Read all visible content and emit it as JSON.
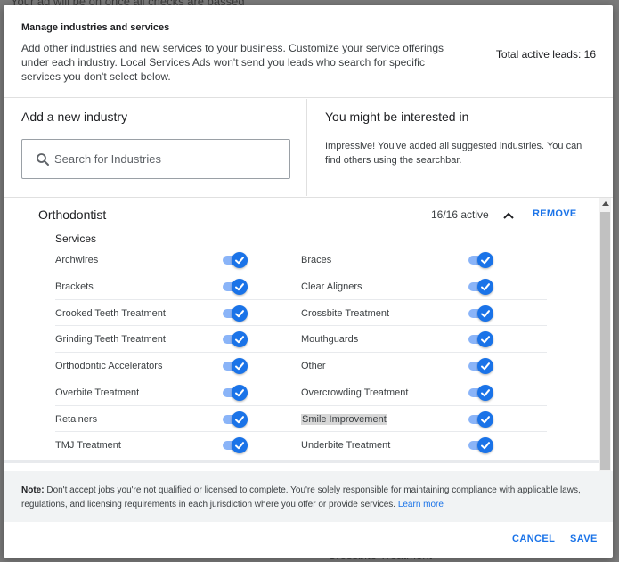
{
  "background": {
    "top_text": "Your ad will be on once all checks are passed",
    "bottom_text": "Crossbite Treatment"
  },
  "header": {
    "title": "Manage industries and services",
    "description": "Add other industries and new services to your business. Customize your service offerings under each industry. Local Services Ads won't send you leads who search for specific services you don't select below.",
    "total_leads": "Total active leads: 16"
  },
  "add_industry": {
    "title": "Add a new industry",
    "search_placeholder": "Search for Industries",
    "search_value": ""
  },
  "suggestions": {
    "title": "You might be interested in",
    "text": "Impressive! You've added all suggested industries. You can find others using the searchbar."
  },
  "industry": {
    "name": "Orthodontist",
    "count": "16/16 active",
    "remove_label": "REMOVE",
    "services_label": "Services",
    "services": [
      {
        "left": "Archwires",
        "left_on": true,
        "right": "Braces",
        "right_on": true
      },
      {
        "left": "Brackets",
        "left_on": true,
        "right": "Clear Aligners",
        "right_on": true
      },
      {
        "left": "Crooked Teeth Treatment",
        "left_on": true,
        "right": "Crossbite Treatment",
        "right_on": true
      },
      {
        "left": "Grinding Teeth Treatment",
        "left_on": true,
        "right": "Mouthguards",
        "right_on": true
      },
      {
        "left": "Orthodontic Accelerators",
        "left_on": true,
        "right": "Other",
        "right_on": true
      },
      {
        "left": "Overbite Treatment",
        "left_on": true,
        "right": "Overcrowding Treatment",
        "right_on": true
      },
      {
        "left": "Retainers",
        "left_on": true,
        "right": "Smile Improvement",
        "right_on": true
      },
      {
        "left": "TMJ Treatment",
        "left_on": true,
        "right": "Underbite Treatment",
        "right_on": true
      }
    ]
  },
  "note": {
    "prefix": "Note:",
    "text": " Don't accept jobs you're not qualified or licensed to complete. You're solely responsible for maintaining compliance with applicable laws, regulations, and licensing requirements in each jurisdiction where you offer or provide services. ",
    "link": "Learn more"
  },
  "footer": {
    "cancel_label": "CANCEL",
    "save_label": "SAVE"
  },
  "colors": {
    "accent": "#1a73e8",
    "toggle_track": "#8ab4f8",
    "highlight": "#d7d7d7"
  }
}
